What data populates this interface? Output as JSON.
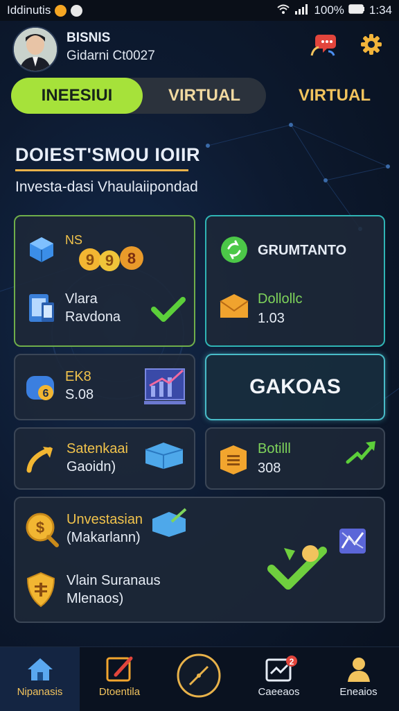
{
  "status_bar": {
    "left_text": "Iddinutis",
    "battery": "100%",
    "time": "1:34"
  },
  "profile": {
    "name": "BISNIS",
    "subtitle": "Gidarni Ct0027"
  },
  "tabs": [
    {
      "label": "INEESIUI",
      "active": true
    },
    {
      "label": "VIRTUAL",
      "active": false
    },
    {
      "label": "VIRTUAL",
      "active": false
    }
  ],
  "section": {
    "title": "DOIEST'SMOU IOIIR",
    "subtitle": "Investa-dasi Vhaulaiipondad"
  },
  "cards": {
    "card_ns": {
      "label": "NS",
      "coins": [
        "9",
        "9",
        "8"
      ],
      "line1": "Vlara",
      "line2": "Ravdona"
    },
    "card_grumtanto": {
      "title": "GRUMTANTO",
      "line1": "Dollollc",
      "line2": "1.03"
    },
    "card_ek": {
      "badge": "6",
      "line1": "EK8",
      "line2": "S.08"
    },
    "card_gakoas": {
      "label": "GAKOAS"
    },
    "card_satenkaai": {
      "line1": "Satenkaai",
      "line2": "Gaoidn)"
    },
    "card_botill": {
      "line1": "Botilll",
      "line2": "308"
    },
    "card_wide": {
      "line1": "Unvestasian",
      "line2": "(Makarlann)",
      "line3": "Vlain Suranaus",
      "line4": "Mlenaos)"
    }
  },
  "bottom_nav": [
    {
      "label": "Nipanasis",
      "icon": "home-icon",
      "active": true
    },
    {
      "label": "Dtoentila",
      "icon": "edit-icon",
      "active": false
    },
    {
      "label": "",
      "icon": "compass-icon",
      "active": false
    },
    {
      "label": "Caeeaos",
      "icon": "chart-icon",
      "badge": "2",
      "active": false
    },
    {
      "label": "Eneaios",
      "icon": "user-icon",
      "active": false
    }
  ],
  "colors": {
    "accent_green": "#a6e23a",
    "accent_gold": "#f2c35d",
    "background": "#0b1424",
    "teal": "#2fb5b5"
  }
}
